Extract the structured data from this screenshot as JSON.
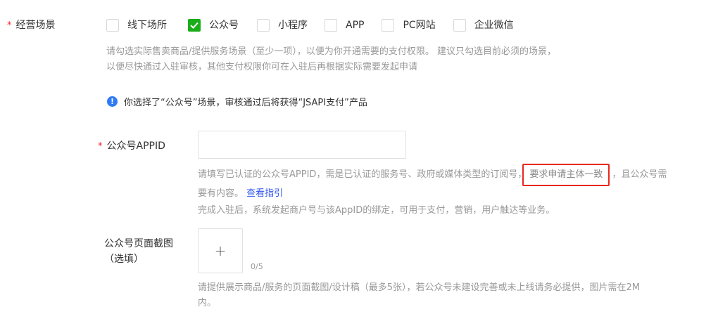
{
  "business_scene": {
    "label": "经营场景",
    "options": [
      {
        "label": "线下场所",
        "checked": false
      },
      {
        "label": "公众号",
        "checked": true
      },
      {
        "label": "小程序",
        "checked": false
      },
      {
        "label": "APP",
        "checked": false
      },
      {
        "label": "PC网站",
        "checked": false
      },
      {
        "label": "企业微信",
        "checked": false
      }
    ],
    "help_line1": "请勾选实际售卖商品/提供服务场景（至少一项），以便为你开通需要的支付权限。 建议只勾选目前必须的场景，",
    "help_line2": "以便尽快通过入驻审核，其他支付权限你可在入驻后再根据实际需要发起申请"
  },
  "notice": {
    "icon": "info-icon",
    "text": "你选择了“公众号”场景，审核通过后将获得“JSAPI支付”产品"
  },
  "appid": {
    "label": "公众号APPID",
    "value": "",
    "placeholder": "",
    "help_part1": "请填写已认证的公众号APPID，需是已认证的服务号、政府或媒体类型的订阅号，",
    "help_highlight": "要求申请主体一致",
    "help_part2": "，且公众号需",
    "help_part3": "要有内容。",
    "help_link": "查看指引",
    "help_line3": "完成入驻后，系统发起商户号与该AppID的绑定，可用于支付，营销，用户触达等业务。"
  },
  "screenshot": {
    "label_line1": "公众号页面截图",
    "label_line2": "（选填）",
    "upload_icon": "+",
    "count": "0/5",
    "help_line1": "请提供展示商品/服务的页面截图/设计稿（最多5张），若公众号未建设完善或未上线请务必提供，图片需在2M",
    "help_line2": "内。"
  },
  "colors": {
    "required": "#f5222d",
    "checked": "#1aad19",
    "info": "#2f7bf5",
    "link": "#2f54eb",
    "highlight_border": "#e8281f",
    "help_text": "#999999"
  }
}
